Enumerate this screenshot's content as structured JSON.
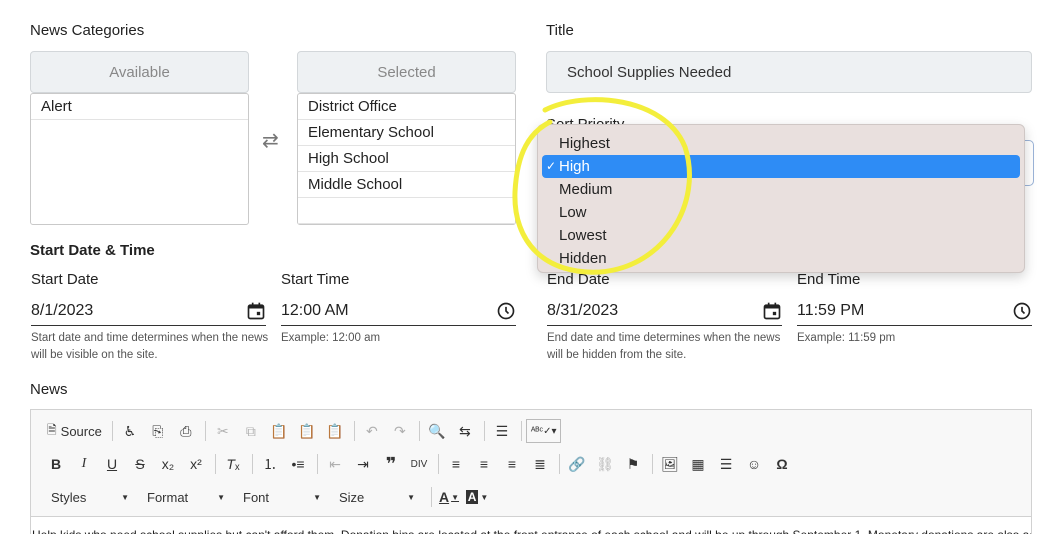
{
  "categories": {
    "heading": "News Categories",
    "available_label": "Available",
    "selected_label": "Selected",
    "available_items": [
      "Alert"
    ],
    "selected_items": [
      "District Office",
      "Elementary School",
      "High School",
      "Middle School"
    ]
  },
  "title_field": {
    "label": "Title",
    "value": "School Supplies Needed"
  },
  "sort_priority": {
    "label": "Sort Priority",
    "options": [
      "Highest",
      "High",
      "Medium",
      "Low",
      "Lowest",
      "Hidden"
    ],
    "selected": "High"
  },
  "start": {
    "heading": "Start Date & Time",
    "date_label": "Start Date",
    "date_value": "8/1/2023",
    "time_label": "Start Time",
    "time_value": "12:00 AM",
    "date_help": "Start date and time determines when the news will be visible on the site.",
    "time_help": "Example: 12:00 am"
  },
  "end": {
    "date_label": "End Date",
    "date_value": "8/31/2023",
    "time_label": "End Time",
    "time_value": "11:59 PM",
    "date_help": "End date and time determines when the news will be hidden from the site.",
    "time_help": "Example: 11:59 pm"
  },
  "news": {
    "label": "News",
    "source_label": "Source",
    "styles_label": "Styles",
    "format_label": "Format",
    "font_label": "Font",
    "size_label": "Size",
    "content": "Help kids who need school supplies but can't afford them. Donation bins are located at the front entrance of each school and will be up through September 1. Monetary donations are also accepted at the drop off"
  },
  "colors": {
    "highlight": "#f3ee3c",
    "selected_option": "#2e8cf5",
    "dropdown_bg": "#e9e0de"
  }
}
